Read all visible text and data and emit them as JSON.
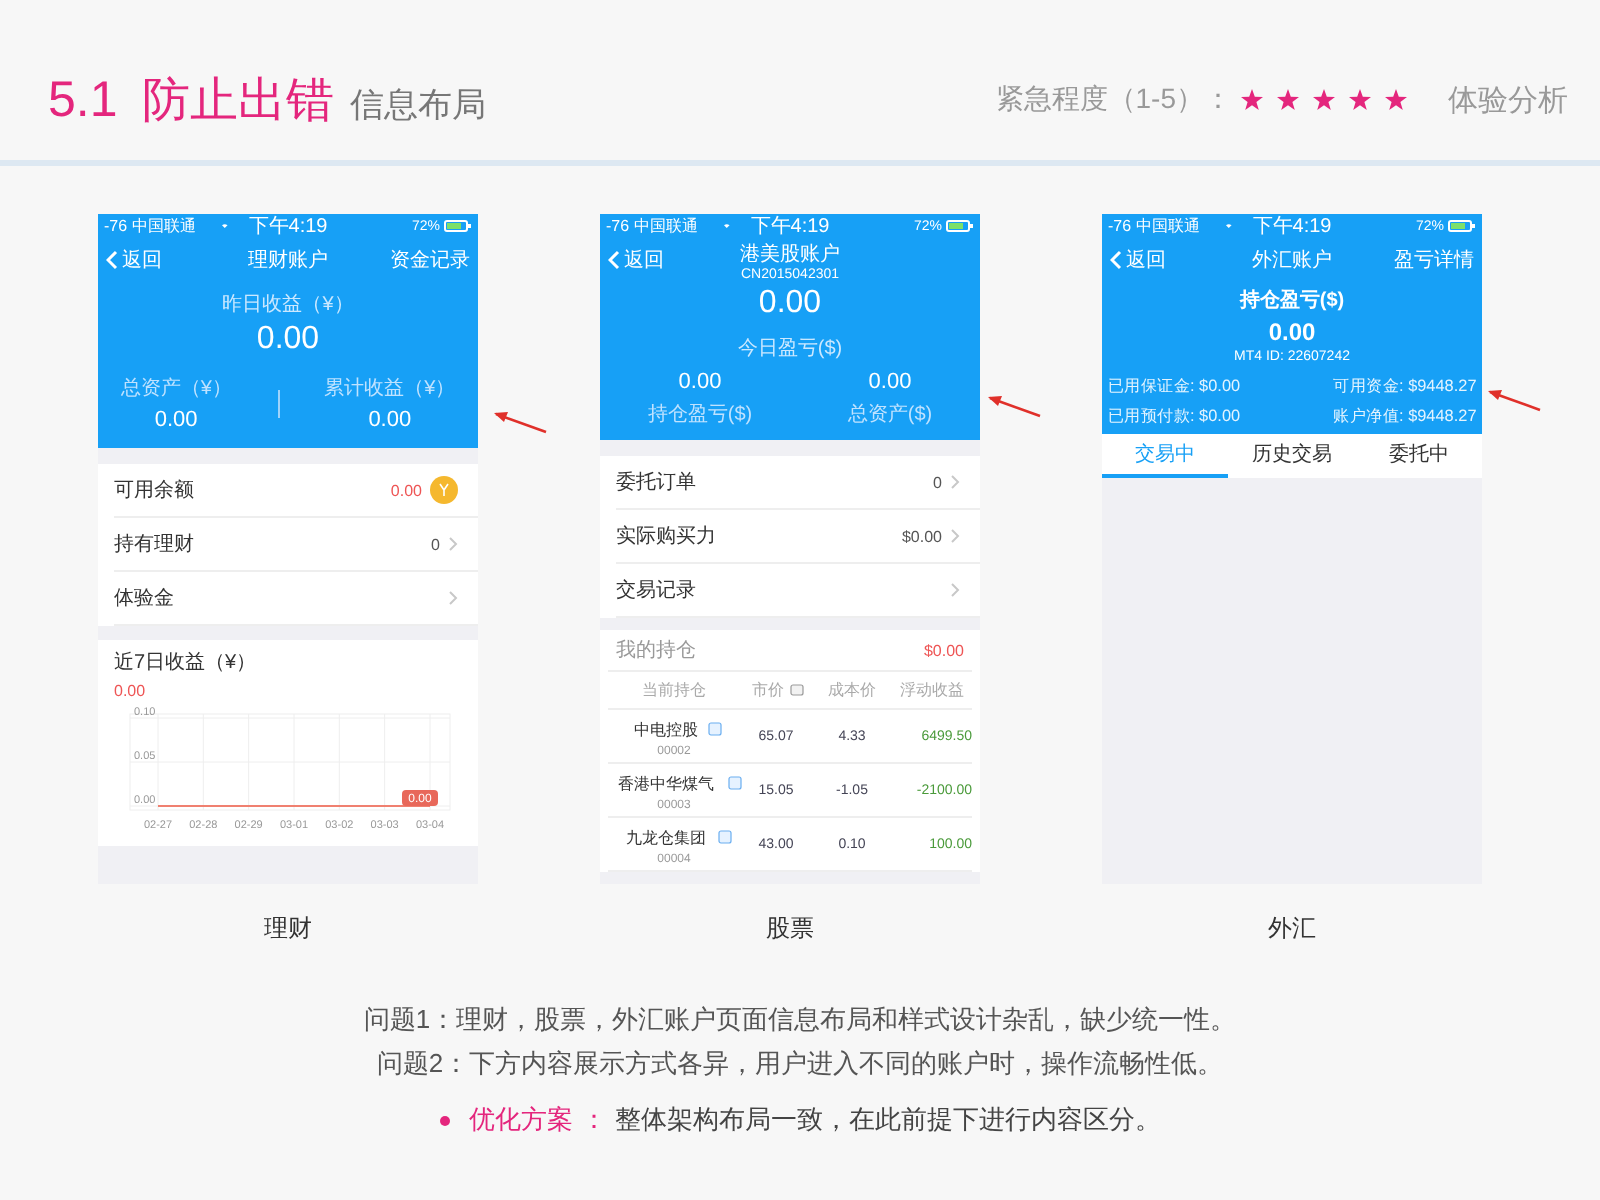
{
  "header": {
    "number": "5.1",
    "title": "防止出错",
    "subtitle": "信息布局",
    "urgency_label": "紧急程度（1-5）：",
    "stars": 5,
    "section": "体验分析"
  },
  "phones": [
    {
      "kind": "wealth",
      "caption": "理财",
      "status_bar": {
        "carrier": "-76 中国联通",
        "time": "下午4:19",
        "battery": "72%"
      },
      "nav": {
        "back": "返回",
        "title": "理财账户",
        "action": "资金记录"
      },
      "summary": {
        "label": "昨日收益（¥）",
        "value": "0.00",
        "stats": [
          {
            "label": "总资产（¥）",
            "value": "0.00"
          },
          {
            "label": "累计收益（¥）",
            "value": "0.00"
          }
        ]
      },
      "rows": [
        {
          "kind": "coin",
          "label": "可用余额",
          "value": "0.00"
        },
        {
          "kind": "chevron",
          "label": "持有理财",
          "value": "0"
        },
        {
          "kind": "chevron",
          "label": "体验金"
        }
      ],
      "chart": {
        "title": "近7日收益（¥）",
        "total": "0.00",
        "badge": "0.00",
        "chart_data": {
          "type": "line",
          "categories": [
            "02-27",
            "02-28",
            "02-29",
            "03-01",
            "03-02",
            "03-03",
            "03-04"
          ],
          "series": [
            {
              "color": "#f08070",
              "values": [
                0,
                0,
                0,
                0,
                0,
                0,
                0
              ]
            }
          ],
          "ylim": [
            0,
            0.1
          ],
          "grid": true,
          "yticks": [
            {
              "value": 0,
              "label": "0.00"
            },
            {
              "value": 0.05,
              "label": "0.05"
            },
            {
              "value": 0.1,
              "label": "0.10"
            }
          ]
        }
      }
    },
    {
      "kind": "stock",
      "caption": "股票",
      "status_bar": {
        "carrier": "-76 中国联通",
        "time": "下午4:19",
        "battery": "72%"
      },
      "nav": {
        "back": "返回",
        "title": "港美股账户",
        "subtitle": "CN2015042301"
      },
      "summary": {
        "label": "今日盈亏($)",
        "value": "0.00",
        "stats": [
          {
            "label": "持仓盈亏($)",
            "value": "0.00"
          },
          {
            "label": "总资产($)",
            "value": "0.00"
          }
        ]
      },
      "rows": [
        {
          "kind": "chevron",
          "label": "委托订单",
          "value": "0"
        },
        {
          "kind": "chevron",
          "label": "实际购买力",
          "value": "$0.00"
        },
        {
          "kind": "chevron",
          "label": "交易记录"
        }
      ],
      "holdings": {
        "title": "我的持仓",
        "total": "$0.00",
        "columns": [
          "当前持仓",
          "市价",
          "成本价",
          "浮动收益"
        ],
        "rows": [
          {
            "name": "中电控股",
            "code": "00002",
            "price": "65.07",
            "cost": "4.33",
            "pnl": "6499.50"
          },
          {
            "name": "香港中华煤气",
            "code": "00003",
            "price": "15.05",
            "cost": "-1.05",
            "pnl": "-2100.00"
          },
          {
            "name": "九龙仓集团",
            "code": "00004",
            "price": "43.00",
            "cost": "0.10",
            "pnl": "100.00"
          }
        ]
      }
    },
    {
      "kind": "forex",
      "caption": "外汇",
      "status_bar": {
        "carrier": "-76 中国联通",
        "time": "下午4:19",
        "battery": "72%"
      },
      "nav": {
        "back": "返回",
        "title": "外汇账户",
        "action": "盈亏详情"
      },
      "summary": {
        "label": "持仓盈亏($)",
        "value": "0.00",
        "account_id": "MT4 ID: 22607242",
        "details": [
          "已用保证金: $0.00",
          "可用资金: $9448.27",
          "已用预付款: $0.00",
          "账户净值: $9448.27"
        ]
      },
      "tabs": [
        {
          "label": "交易中",
          "selected": true
        },
        {
          "label": "历史交易",
          "selected": false
        },
        {
          "label": "委托中",
          "selected": false
        }
      ]
    }
  ],
  "notes": {
    "problems": [
      "问题1：理财，股票，外汇账户页面信息布局和样式设计杂乱，缺少统一性。",
      "问题2：下方内容展示方式各异，用户进入不同的账户时，操作流畅性低。"
    ],
    "solution": {
      "label": "优化方案 ：",
      "text": "整体架构布局一致，在此前提下进行内容区分。"
    }
  }
}
